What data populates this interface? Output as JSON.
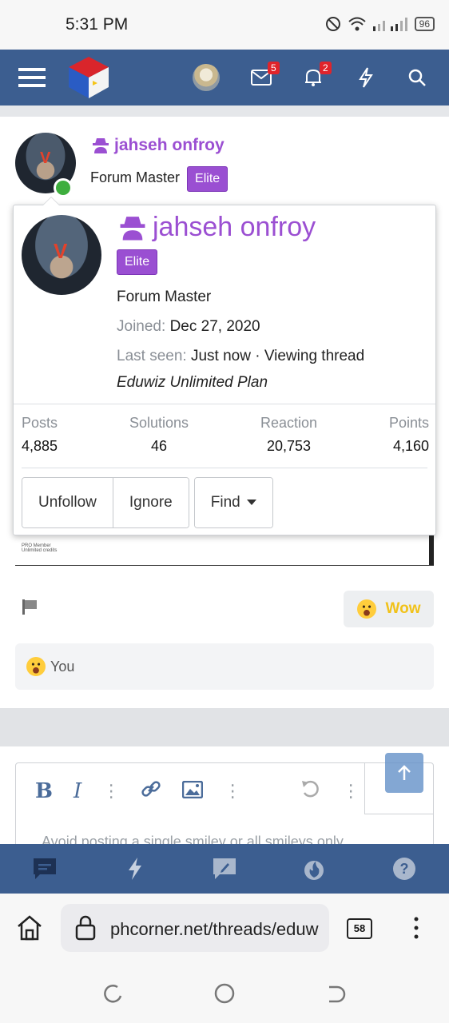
{
  "status_bar": {
    "time": "5:31 PM",
    "battery": "96"
  },
  "top_nav": {
    "inbox_badge": "5",
    "alerts_badge": "2"
  },
  "post": {
    "username": "jahseh onfroy",
    "user_title": "Forum Master",
    "banner": "Elite"
  },
  "member_card": {
    "username": "jahseh onfroy",
    "banner": "Elite",
    "user_title": "Forum Master",
    "joined_label": "Joined:",
    "joined_value": "Dec 27, 2020",
    "last_seen_label": "Last seen:",
    "last_seen_value": "Just now · Viewing thread",
    "plan": "Eduwiz Unlimited Plan",
    "stats": [
      {
        "label": "Posts",
        "value": "4,885"
      },
      {
        "label": "Solutions",
        "value": "46"
      },
      {
        "label": "Reaction",
        "value": "20,753"
      },
      {
        "label": "Points",
        "value": "4,160"
      }
    ],
    "buttons": {
      "unfollow": "Unfollow",
      "ignore": "Ignore",
      "find": "Find"
    }
  },
  "attachment": {
    "caption": "PRO Member",
    "subcaption": "Unlimited credits"
  },
  "reaction": {
    "wow_label": "Wow",
    "reacted_by": "You"
  },
  "editor": {
    "placeholder": "Avoid posting a single smiley or all smileys only"
  },
  "browser": {
    "url": "phcorner.net/threads/eduw",
    "tab_count": "58"
  },
  "colors": {
    "nav_bg": "#3c5e90",
    "username_purple": "#9b4fd2",
    "elite_bg": "#9a4fd2",
    "online_green": "#3eae3e",
    "badge_red": "#e0242b"
  }
}
